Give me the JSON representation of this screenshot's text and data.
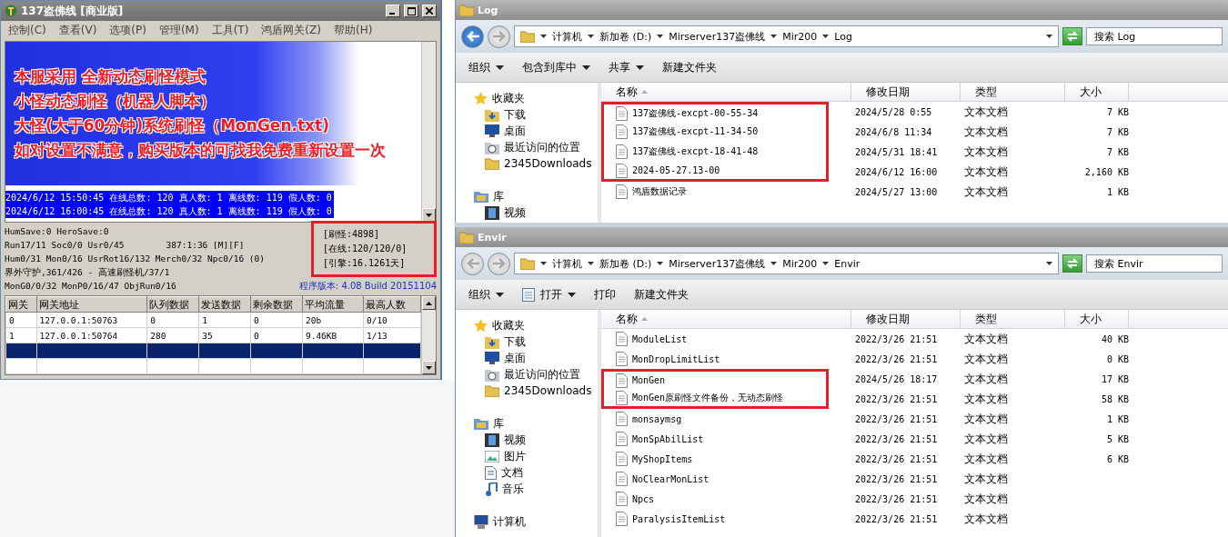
{
  "server_window": {
    "title": "137盗佛线 [商业版]",
    "menu": [
      "控制(C)",
      "查看(V)",
      "选项(P)",
      "管理(M)",
      "工具(T)",
      "鸿盾网关(Z)",
      "帮助(H)"
    ],
    "banner": [
      "本服采用 全新动态刷怪模式",
      "小怪动态刷怪（机器人脚本）",
      "大怪(大于60分钟)系统刷怪（MonGen.txt)",
      "如对设置不满意，购买版本的可找我免费重新设置一次"
    ],
    "log_lines": [
      "2024/6/12 15:50:45 在线总数: 120 真人数: 1 离线数: 119 假人数: 0",
      "2024/6/12 16:00:45 在线总数: 120 真人数: 1 离线数: 119 假人数: 0"
    ],
    "status_lines": [
      {
        "text": "HumSave:0 HeroSave:0"
      },
      {
        "text": "Run17/11 Soc0/0 Usr0/45",
        "extra": "387:1:36 [M][F]"
      },
      {
        "text": "Hum0/31 Mon0/16 UsrRot16/132 Merch0/32 Npc0/16 (0)"
      },
      {
        "text": "界外守护,361/426 - 高速刷怪机/37/1"
      }
    ],
    "bottom_line": "MonG0/0/32 MonP0/16/47 ObjRun0/16",
    "version": "程序版本: 4.08 Build 20151104",
    "stats": {
      "highlighted": true,
      "lines": [
        "[刷怪:4898]",
        "[在线:120/120/0]",
        "[引擎:16.1261天]"
      ]
    },
    "gateway_table": {
      "columns": [
        "网关",
        "网关地址",
        "队列数据",
        "发送数据",
        "剩余数据",
        "平均流量",
        "最高人数"
      ],
      "rows": [
        {
          "cells": [
            "0",
            "127.0.0.1:50763",
            "0",
            "1",
            "0",
            "20b",
            "0/10"
          ],
          "selected": false
        },
        {
          "cells": [
            "1",
            "127.0.0.1:50764",
            "280",
            "35",
            "0",
            "9.46KB",
            "1/13"
          ],
          "selected": false
        },
        {
          "selected": true
        },
        {
          "selected": false
        }
      ]
    }
  },
  "explorer_windows": [
    {
      "title": "Log",
      "back_enabled": true,
      "path": [
        "计算机",
        "新加卷 (D:)",
        "Mirserver137盗佛线",
        "Mir200",
        "Log"
      ],
      "search": {
        "placeholder": "搜索 Log"
      },
      "toolbar": [
        {
          "label": "组织",
          "dropdown": true
        },
        {
          "label": "包含到库中",
          "dropdown": true
        },
        {
          "label": "共享",
          "dropdown": true
        },
        {
          "label": "新建文件夹",
          "dropdown": false
        }
      ],
      "nav": [
        {
          "label": "收藏夹",
          "kind": "favorites",
          "children": [
            {
              "label": "下载",
              "kind": "downloads"
            },
            {
              "label": "桌面",
              "kind": "desktop"
            },
            {
              "label": "最近访问的位置",
              "kind": "recent"
            },
            {
              "label": "2345Downloads",
              "kind": "folder"
            }
          ]
        },
        {
          "label": "库",
          "kind": "library",
          "children": [
            {
              "label": "视频",
              "kind": "video"
            }
          ]
        }
      ],
      "columns": [
        "名称",
        "修改日期",
        "类型",
        "大小"
      ],
      "rows": [
        {
          "name": "137盗佛线-excpt-00-55-34",
          "date": "2024/5/28 0:55",
          "type": "文本文档",
          "size": "7 KB",
          "highlighted": true
        },
        {
          "name": "137盗佛线-excpt-11-34-50",
          "date": "2024/6/8 11:34",
          "type": "文本文档",
          "size": "7 KB",
          "highlighted": true
        },
        {
          "name": "137盗佛线-excpt-18-41-48",
          "date": "2024/5/31 18:41",
          "type": "文本文档",
          "size": "7 KB",
          "highlighted": true
        },
        {
          "name": "2024-05-27.13-00",
          "date": "2024/6/12 16:00",
          "type": "文本文档",
          "size": "2,160 KB",
          "highlighted": true
        },
        {
          "name": "鸿盾数据记录",
          "date": "2024/5/27 13:00",
          "type": "文本文档",
          "size": "1 KB",
          "highlighted": false
        }
      ]
    },
    {
      "title": "Envir",
      "back_enabled": false,
      "path": [
        "计算机",
        "新加卷 (D:)",
        "Mirserver137盗佛线",
        "Mir200",
        "Envir"
      ],
      "search": {
        "placeholder": "搜索 Envir"
      },
      "toolbar": [
        {
          "label": "组织",
          "dropdown": true
        },
        {
          "label": "打开",
          "dropdown": true,
          "kind": "open"
        },
        {
          "label": "打印",
          "dropdown": false
        },
        {
          "label": "新建文件夹",
          "dropdown": false
        }
      ],
      "nav": [
        {
          "label": "收藏夹",
          "kind": "favorites",
          "children": [
            {
              "label": "下载",
              "kind": "downloads"
            },
            {
              "label": "桌面",
              "kind": "desktop"
            },
            {
              "label": "最近访问的位置",
              "kind": "recent"
            },
            {
              "label": "2345Downloads",
              "kind": "folder"
            }
          ]
        },
        {
          "label": "库",
          "kind": "library",
          "children": [
            {
              "label": "视频",
              "kind": "video"
            },
            {
              "label": "图片",
              "kind": "picture"
            },
            {
              "label": "文档",
              "kind": "document"
            },
            {
              "label": "音乐",
              "kind": "music"
            }
          ]
        },
        {
          "label": "计算机",
          "kind": "computer"
        }
      ],
      "columns": [
        "名称",
        "修改日期",
        "类型",
        "大小"
      ],
      "rows": [
        {
          "name": "ModuleList",
          "date": "2022/3/26 21:51",
          "type": "文本文档",
          "size": "40 KB",
          "highlighted": false
        },
        {
          "name": "MonDropLimitList",
          "date": "2022/3/26 21:51",
          "type": "文本文档",
          "size": "0 KB",
          "highlighted": false
        },
        {
          "name": "MonGen",
          "date": "2024/5/26 18:17",
          "type": "文本文档",
          "size": "17 KB",
          "highlighted": true
        },
        {
          "name": "MonGen原刷怪文件备份，无动态刷怪",
          "date": "2022/3/26 21:51",
          "type": "文本文档",
          "size": "58 KB",
          "highlighted": true
        },
        {
          "name": "monsaymsg",
          "date": "2022/3/26 21:51",
          "type": "文本文档",
          "size": "1 KB",
          "highlighted": false
        },
        {
          "name": "MonSpAbilList",
          "date": "2022/3/26 21:51",
          "type": "文本文档",
          "size": "5 KB",
          "highlighted": false
        },
        {
          "name": "MyShopItems",
          "date": "2022/3/26 21:51",
          "type": "文本文档",
          "size": "6 KB",
          "highlighted": false
        },
        {
          "name": "NoClearMonList",
          "date": "2022/3/26 21:51",
          "type": "文本文档",
          "highlighted": false
        },
        {
          "name": "Npcs",
          "date": "2022/3/26 21:51",
          "type": "文本文档",
          "highlighted": false
        },
        {
          "name": "ParalysisItemList",
          "date": "2022/3/26 21:51",
          "type": "文本文档",
          "highlighted": false
        }
      ]
    }
  ]
}
